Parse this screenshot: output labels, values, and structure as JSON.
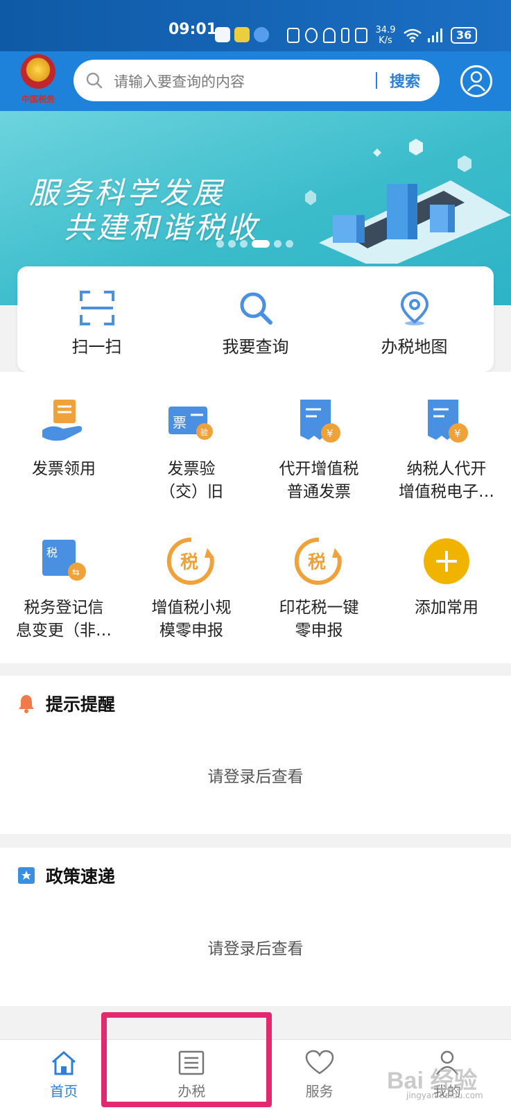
{
  "status_bar": {
    "time": "09:01",
    "speed_top": "34.9",
    "speed_bottom": "K/s",
    "battery": "36"
  },
  "header": {
    "logo_text": "中国税务",
    "search_placeholder": "请输入要查询的内容",
    "search_button": "搜索"
  },
  "banner": {
    "line1": "服务科学发展",
    "line2": "共建和谐税收",
    "dots": 6,
    "active_dot": 4
  },
  "quick_actions": [
    {
      "label": "扫一扫",
      "icon": "scan-icon"
    },
    {
      "label": "我要查询",
      "icon": "search-icon"
    },
    {
      "label": "办税地图",
      "icon": "map-pin-icon"
    }
  ],
  "services": [
    {
      "label": "发票领用",
      "icon": "invoice-receive-icon"
    },
    {
      "label": "发票验\n（交）旧",
      "icon": "invoice-check-icon"
    },
    {
      "label": "代开增值税\n普通发票",
      "icon": "vat-invoice-icon"
    },
    {
      "label": "纳税人代开\n增值税电子…",
      "icon": "vat-e-invoice-icon"
    },
    {
      "label": "税务登记信\n息变更（非…",
      "icon": "tax-registration-icon"
    },
    {
      "label": "增值税小规\n模零申报",
      "icon": "vat-zero-declare-icon"
    },
    {
      "label": "印花税一键\n零申报",
      "icon": "stamp-tax-declare-icon"
    },
    {
      "label": "添加常用",
      "icon": "add-icon"
    }
  ],
  "reminder": {
    "title": "提示提醒",
    "message": "请登录后查看"
  },
  "policy": {
    "title": "政策速递",
    "message": "请登录后查看"
  },
  "tabs": [
    {
      "label": "首页",
      "active": true
    },
    {
      "label": "办税",
      "active": false
    },
    {
      "label": "服务",
      "active": false
    },
    {
      "label": "我的",
      "active": false
    }
  ],
  "watermark": {
    "main": "Bai 经验",
    "sub": "jingyan.baidu.com"
  },
  "colors": {
    "primary": "#1e82db",
    "accent_blue": "#2d7fd9",
    "orange": "#f0a23a",
    "highlight": "#e2286f"
  }
}
